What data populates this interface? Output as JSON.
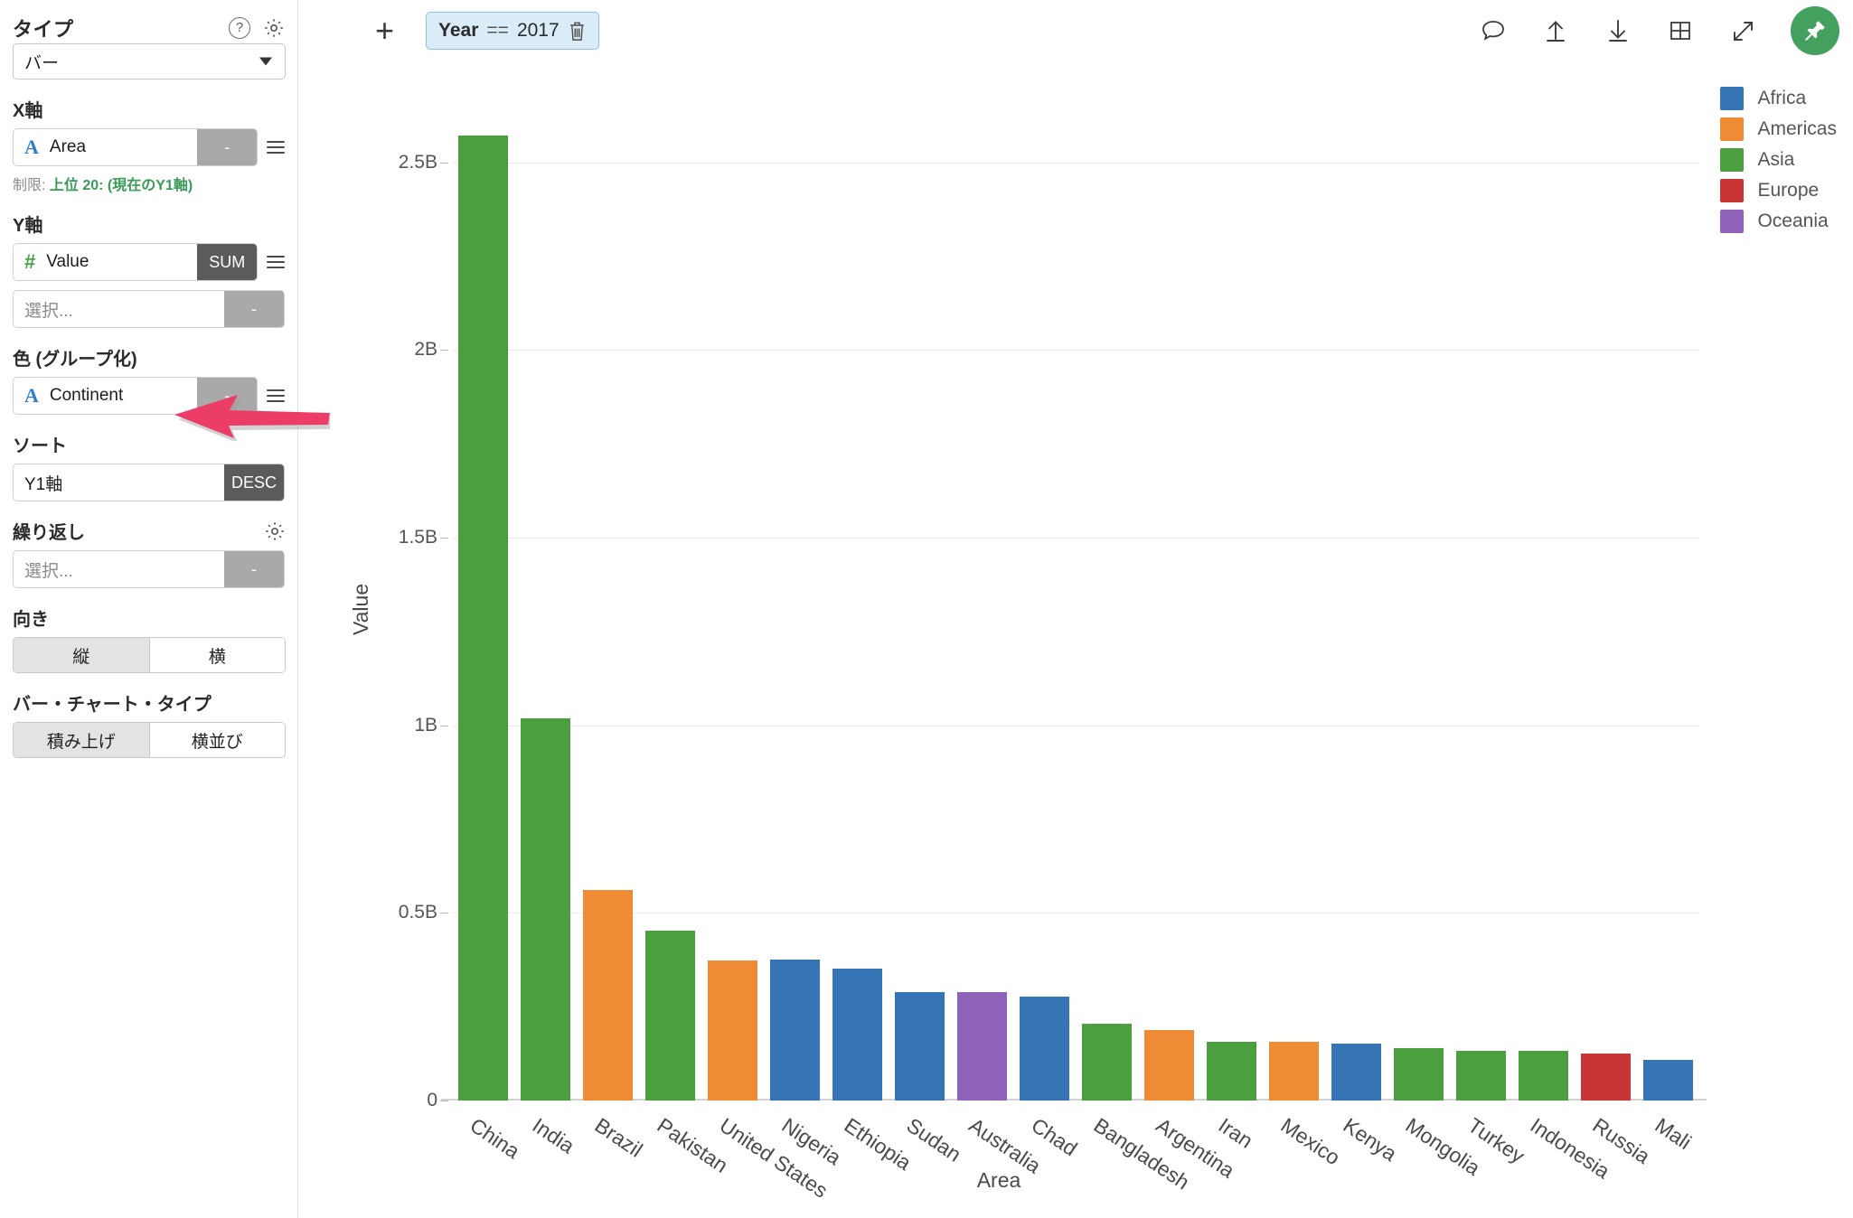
{
  "sidebar": {
    "type_section": {
      "label": "タイプ",
      "help_icon": "question-mark-circle-icon",
      "gear_icon": "gear-icon",
      "selected": "バー"
    },
    "x_axis": {
      "label": "X軸",
      "field_icon": "A",
      "field": "Area",
      "agg": "-",
      "limit_prefix": "制限:",
      "limit_value": "上位 20: (現在のY1軸)"
    },
    "y_axis": {
      "label": "Y軸",
      "field_icon": "#",
      "field": "Value",
      "agg": "SUM",
      "second_placeholder": "選択...",
      "second_agg": "-"
    },
    "color_group": {
      "label": "色 (グループ化)",
      "field_icon": "A",
      "field": "Continent",
      "agg": "-"
    },
    "sort": {
      "label": "ソート",
      "field": "Y1軸",
      "direction": "DESC"
    },
    "repeat": {
      "label": "繰り返し",
      "gear_icon": "gear-icon",
      "placeholder": "選択...",
      "agg": "-"
    },
    "orientation": {
      "label": "向き",
      "options": [
        "縦",
        "横"
      ],
      "active_index": 0
    },
    "bar_chart_type": {
      "label": "バー・チャート・タイプ",
      "options": [
        "積み上げ",
        "横並び"
      ],
      "active_index": 0
    }
  },
  "topbar": {
    "add_label": "+",
    "filter": {
      "field": "Year",
      "operator": "==",
      "value": "2017",
      "delete_icon": "trash-icon"
    },
    "icons": [
      "comment-icon",
      "upload-icon",
      "download-icon",
      "table-icon",
      "expand-icon"
    ],
    "pin_icon": "pin-icon",
    "pin_color": "#43a05f"
  },
  "legend": {
    "position": "right",
    "items": [
      {
        "label": "Africa",
        "color": "#3575b5"
      },
      {
        "label": "Americas",
        "color": "#ef8b35"
      },
      {
        "label": "Asia",
        "color": "#4c9f3e"
      },
      {
        "label": "Europe",
        "color": "#c93434"
      },
      {
        "label": "Oceania",
        "color": "#9063ba"
      }
    ]
  },
  "chart_data": {
    "type": "bar",
    "title": "",
    "xlabel": "Area",
    "ylabel": "Value",
    "ylim": [
      0,
      2.62
    ],
    "yunit": "B",
    "grid": true,
    "legend_position": "right",
    "ytick_labels": [
      "0",
      "0.5B",
      "1B",
      "1.5B",
      "2B",
      "2.5B"
    ],
    "ytick_values": [
      0,
      0.5,
      1,
      1.5,
      2,
      2.5
    ],
    "categories": [
      "China",
      "India",
      "Brazil",
      "Pakistan",
      "United States",
      "Nigeria",
      "Ethiopia",
      "Sudan",
      "Australia",
      "Chad",
      "Bangladesh",
      "Argentina",
      "Iran",
      "Mexico",
      "Kenya",
      "Mongolia",
      "Turkey",
      "Indonesia",
      "Russia",
      "Mali"
    ],
    "values": [
      2.573,
      1.019,
      0.561,
      0.453,
      0.373,
      0.376,
      0.352,
      0.289,
      0.289,
      0.277,
      0.205,
      0.188,
      0.157,
      0.157,
      0.152,
      0.14,
      0.133,
      0.133,
      0.125,
      0.108
    ],
    "groups": [
      "Asia",
      "Asia",
      "Americas",
      "Asia",
      "Americas",
      "Africa",
      "Africa",
      "Africa",
      "Oceania",
      "Africa",
      "Asia",
      "Americas",
      "Asia",
      "Americas",
      "Africa",
      "Asia",
      "Asia",
      "Asia",
      "Europe",
      "Africa"
    ],
    "group_colors": {
      "Africa": "#3575b5",
      "Americas": "#ef8b35",
      "Asia": "#4c9f3e",
      "Europe": "#c93434",
      "Oceania": "#9063ba"
    }
  }
}
